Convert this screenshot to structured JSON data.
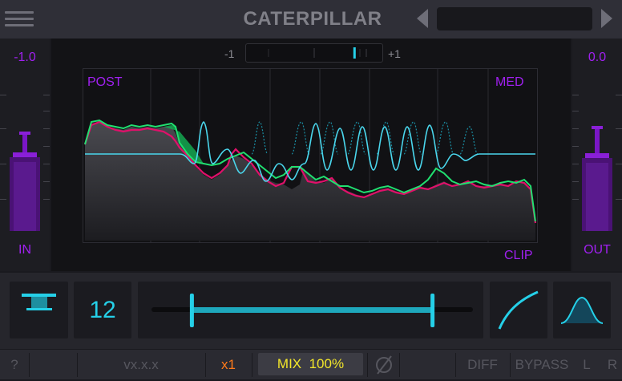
{
  "header": {
    "title": "CATERPILLAR",
    "menu_icon": "hamburger-icon",
    "prev_icon": "triangle-left-icon",
    "next_icon": "triangle-right-icon",
    "preset_value": ""
  },
  "input": {
    "value": "-1.0",
    "label": "IN"
  },
  "output": {
    "value": "0.0",
    "label": "OUT"
  },
  "correlation": {
    "min_label": "-1",
    "max_label": "+1",
    "value": 0.65
  },
  "graph": {
    "top_left": "POST",
    "top_right": "MED",
    "bottom_right": "CLIP"
  },
  "controls": {
    "mode_icon": "filter-shelf-icon",
    "bands": "12",
    "curve_icon": "curve-icon",
    "bell_icon": "bell-shape-icon",
    "range": [
      0.12,
      0.88
    ]
  },
  "footer": {
    "help": "?",
    "version": "vx.x.x",
    "oversample": "x1",
    "mix_label": "MIX",
    "mix_value": "100%",
    "phase_icon": "phase-invert-icon",
    "diff": "DIFF",
    "bypass": "BYPASS",
    "left": "L",
    "right": "R"
  },
  "colors": {
    "accent": "#25d0e8",
    "purple": "#a020f0",
    "magenta": "#e0106a",
    "green": "#20e070",
    "mix_text": "#f2e62a",
    "oversample": "#ff7a1a"
  }
}
